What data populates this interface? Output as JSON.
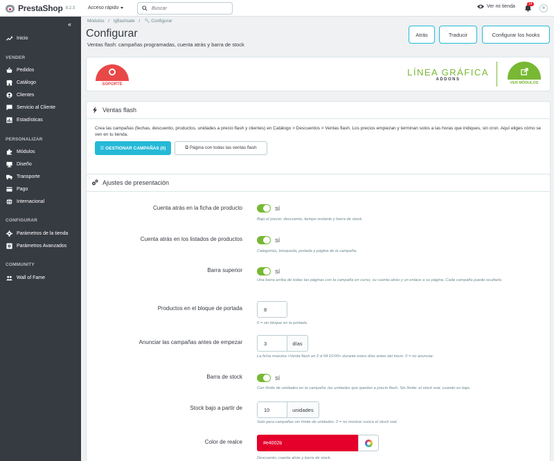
{
  "header": {
    "brand": "PrestaShop",
    "version": "8.2.3",
    "quick_access": "Acceso rápido",
    "search_placeholder": "Buscar",
    "view_shop": "Ver mi tienda",
    "notifications": "14"
  },
  "sidebar": {
    "items": [
      {
        "label": "Inicio"
      },
      {
        "section": "VENDER"
      },
      {
        "label": "Pedidos"
      },
      {
        "label": "Catálogo"
      },
      {
        "label": "Clientes"
      },
      {
        "label": "Servicio al Cliente"
      },
      {
        "label": "Estadísticas"
      },
      {
        "section": "PERSONALIZAR"
      },
      {
        "label": "Módulos"
      },
      {
        "label": "Diseño"
      },
      {
        "label": "Transporte"
      },
      {
        "label": "Pago"
      },
      {
        "label": "Internacional"
      },
      {
        "section": "CONFIGURAR"
      },
      {
        "label": "Parámetros de la tienda"
      },
      {
        "label": "Parámetros Avanzados"
      },
      {
        "section": "COMMUNITY"
      },
      {
        "label": "Wall of Fame"
      }
    ]
  },
  "breadcrumb": {
    "p1": "Módulos",
    "sep": "/",
    "p2": "lgflashsale",
    "p3": "Configurar"
  },
  "page": {
    "title": "Configurar",
    "subtitle": "Ventas flash: campañas programadas, cuenta atrás y barra de stock"
  },
  "toolbar": {
    "back": "Atrás",
    "translate": "Traducir",
    "hooks": "Configurar los hooks"
  },
  "banner": {
    "support": "SOPORTE",
    "logo_big": "LÍNEA GRÁFICA",
    "logo_small": "ADDONS",
    "view_modules": "VER MÓDULOS"
  },
  "flash": {
    "title": "Ventas flash",
    "description": "Crea las campañas (fechas, descuento, productos, unidades a precio flash y clientes) en Catálogo > Descuentos > Ventas flash. Los precios empiezan y terminan solos a las horas que indiques, sin cron. Aquí eliges cómo se ven en tu tienda.",
    "manage_btn": "GESTIONAR CAMPAÑAS (0)",
    "all_sales_btn": "Página con todas las ventas flash"
  },
  "settings": {
    "title": "Ajustes de presentación",
    "product_countdown": {
      "label": "Cuenta atrás en la ficha de producto",
      "value": "SÍ",
      "help": "Bajo el precio: descuento, tiempo restante y barra de stock."
    },
    "list_countdown": {
      "label": "Cuenta atrás en los listados de productos",
      "value": "SÍ",
      "help": "Categorías, búsqueda, portada y página de la campaña."
    },
    "top_bar": {
      "label": "Barra superior",
      "value": "SÍ",
      "help": "Una barra arriba de todas las páginas con la campaña en curso, su cuenta atrás y un enlace a su página. Cada campaña puede ocultarlo."
    },
    "home_products": {
      "label": "Productos en el bloque de portada",
      "value": "8",
      "help": "0 = sin bloque en la portada."
    },
    "announce": {
      "label": "Anunciar las campañas antes de empezar",
      "value": "3",
      "unit": "días",
      "help": "La ficha muestra «Venta flash en 2 d 04:10:00» durante estos días antes del inicio. 0 = no anunciar."
    },
    "stock_bar": {
      "label": "Barra de stock",
      "value": "SÍ",
      "help": "Con límite de unidades en la campaña: las unidades que quedan a precio flash. Sin límite: el stock real, cuando es bajo."
    },
    "low_stock": {
      "label": "Stock bajo a partir de",
      "value": "10",
      "unit": "unidades",
      "help": "Solo para campañas sin límite de unidades. 0 = no mostrar nunca el stock real."
    },
    "color": {
      "label": "Color de realce",
      "value": "#e4002b",
      "help": "Descuento, cuenta atrás y barra de stock."
    }
  },
  "colors": {
    "accent": "#25b9d7",
    "success": "#78b833",
    "highlight": "#e4002b",
    "sidebar": "#363a41"
  }
}
